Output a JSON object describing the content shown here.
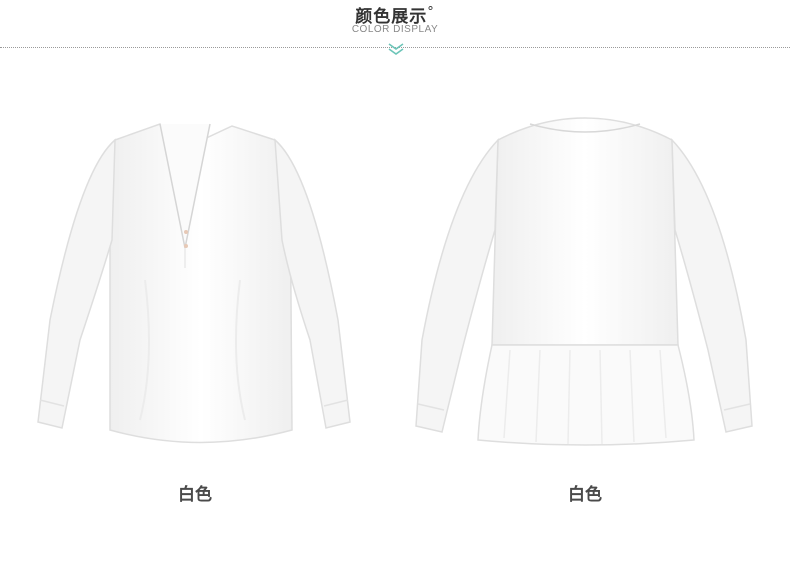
{
  "header": {
    "title": "颜色展示",
    "degree": "°",
    "subtitle": "COLOR DISPLAY"
  },
  "products": [
    {
      "label": "白色",
      "view": "front"
    },
    {
      "label": "白色",
      "view": "back"
    }
  ],
  "colors": {
    "fabric": "#ffffff",
    "fabric_shadow": "#e9e9e9",
    "accent": "#6cc5b8"
  }
}
